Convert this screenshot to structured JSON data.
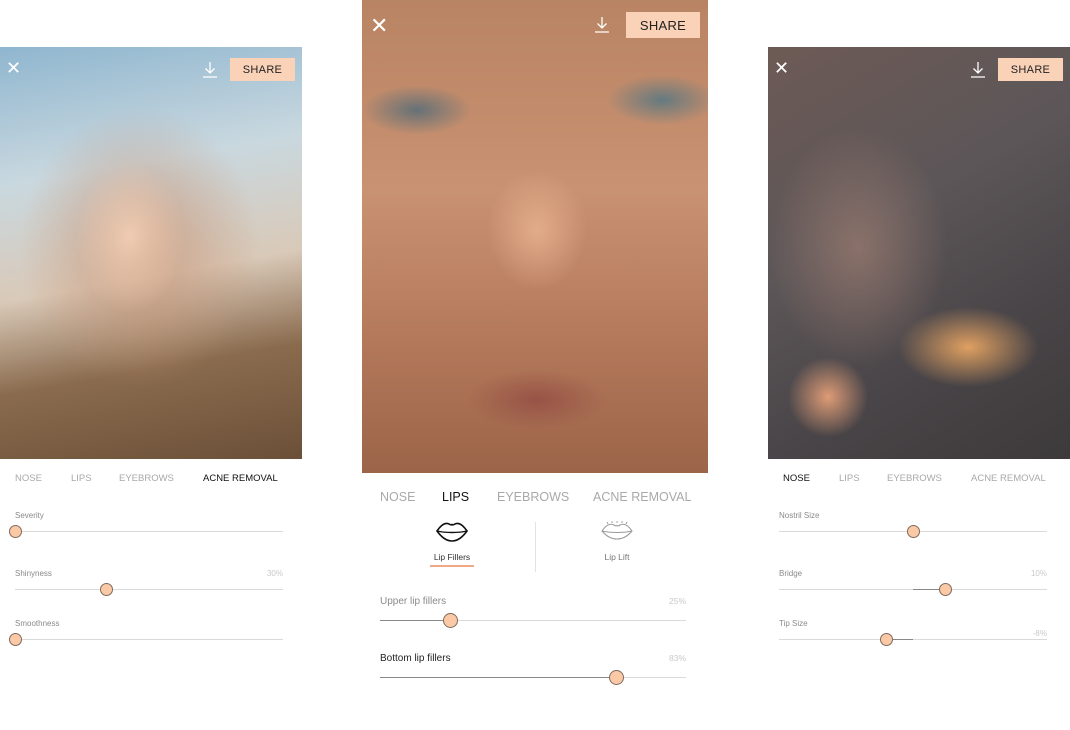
{
  "panels": {
    "left": {
      "share_label": "SHARE",
      "tabs": [
        "NOSE",
        "LIPS",
        "EYEBROWS",
        "ACNE REMOVAL"
      ],
      "active_tab": "ACNE REMOVAL",
      "sliders": [
        {
          "label": "Severity",
          "value_text": "",
          "position": 0.0
        },
        {
          "label": "Shinyness",
          "value_text": "30%",
          "position": 0.34
        },
        {
          "label": "Smoothness",
          "value_text": "",
          "position": 0.0
        }
      ]
    },
    "center": {
      "share_label": "SHARE",
      "tabs": [
        "NOSE",
        "LIPS",
        "EYEBROWS",
        "ACNE REMOVAL"
      ],
      "active_tab": "LIPS",
      "options": [
        {
          "label": "Lip Fillers",
          "icon": "lips-filled-icon",
          "selected": true
        },
        {
          "label": "Lip Lift",
          "icon": "lips-outline-icon",
          "selected": false
        }
      ],
      "sliders": [
        {
          "label": "Upper lip fillers",
          "value_text": "25%",
          "position": 0.23
        },
        {
          "label": "Bottom lip fillers",
          "value_text": "83%",
          "position": 0.77
        }
      ]
    },
    "right": {
      "share_label": "SHARE",
      "tabs": [
        "NOSE",
        "LIPS",
        "EYEBROWS",
        "ACNE REMOVAL"
      ],
      "active_tab": "NOSE",
      "sliders": [
        {
          "label": "Nostril Size",
          "value_text": "",
          "position": 0.5
        },
        {
          "label": "Bridge",
          "value_text": "10%",
          "position": 0.62
        },
        {
          "label": "Tip Size",
          "value_text": "-8%",
          "position": 0.4
        }
      ]
    }
  },
  "colors": {
    "accent": "#f9d2b8",
    "thumb": "#fbc9a5",
    "underline": "#f2a78a"
  }
}
